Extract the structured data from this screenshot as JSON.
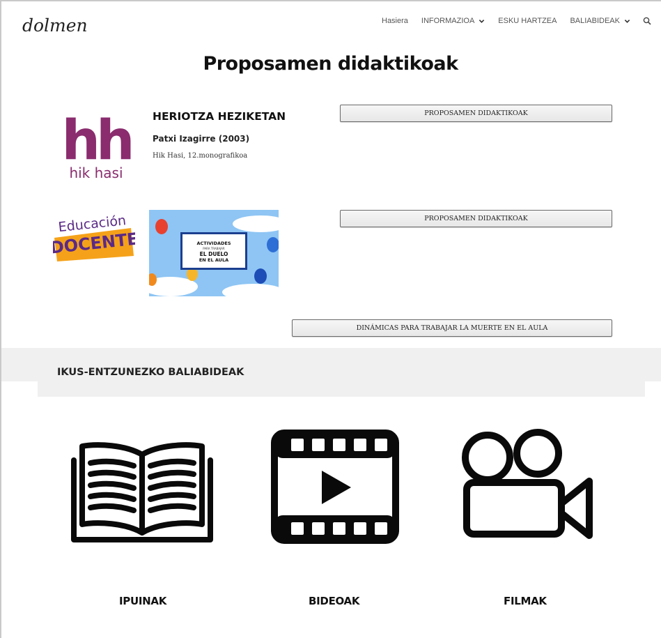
{
  "header": {
    "logo_text": "dolmen",
    "nav": [
      {
        "label": "Hasiera",
        "dropdown": false
      },
      {
        "label": "INFORMAZIOA",
        "dropdown": true
      },
      {
        "label": "ESKU HARTZEA",
        "dropdown": false
      },
      {
        "label": "BALIABIDEAK",
        "dropdown": true
      }
    ]
  },
  "page": {
    "title": "Proposamen didaktikoak"
  },
  "resource1": {
    "logo_letters": "hh",
    "logo_caption": "hik hasi",
    "title": "HERIOTZA HEZIKETAN",
    "author": "Patxi Izagirre (2003)",
    "source": "Hik Hasi, 12.monografikoa",
    "button": "PROPOSAMEN DIDAKTIKOAK"
  },
  "resource2": {
    "logo_line1": "Educación",
    "logo_line2": "DOCENTE",
    "image_text": {
      "line1": "ACTIVIDADES",
      "line2": "PARA TRABAJAR",
      "line3": "EL DUELO",
      "line4": "EN EL AULA"
    },
    "button": "PROPOSAMEN DIDAKTIKOAK"
  },
  "resource3": {
    "button": "DINÁMICAS PARA TRABAJAR LA MUERTE EN EL AULA"
  },
  "section": {
    "title": "IKUS-ENTZUNEZKO BALIABIDEAK"
  },
  "categories": [
    {
      "label": "IPUINAK",
      "icon": "open-book-icon"
    },
    {
      "label": "BIDEOAK",
      "icon": "film-play-icon"
    },
    {
      "label": "FILMAK",
      "icon": "movie-camera-icon"
    }
  ],
  "colors": {
    "hh_purple": "#8a2c6e",
    "docente_purple": "#5b2a86",
    "docente_orange": "#f5a21a"
  }
}
